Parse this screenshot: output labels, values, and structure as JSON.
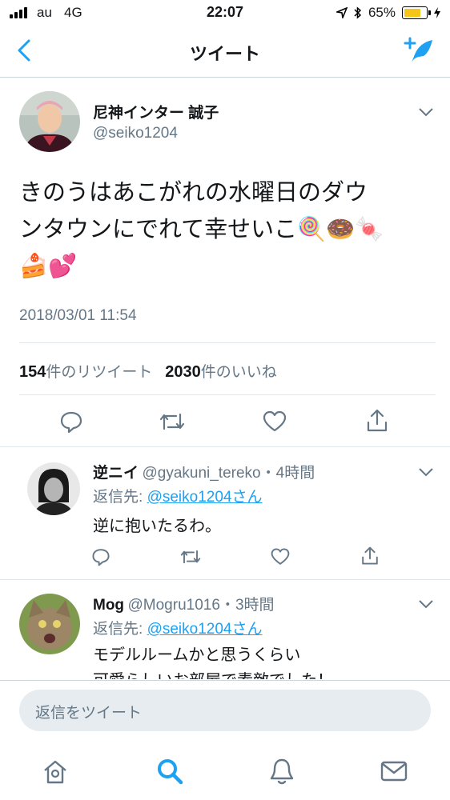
{
  "status_bar": {
    "carrier": "au",
    "network": "4G",
    "time": "22:07",
    "battery": "65%"
  },
  "nav": {
    "title": "ツイート"
  },
  "tweet": {
    "author_name": "尼神インター 誠子",
    "author_handle": "@seiko1204",
    "text_line1": "きのうはあこがれの水曜日のダウ",
    "text_line2": "ンタウンにでれて幸せいこ🍭🍩🍬",
    "text_line3": "🍰💕",
    "timestamp": "2018/03/01 11:54",
    "retweet_count": "154",
    "retweet_label": "件のリツイート",
    "like_count": "2030",
    "like_label": "件のいいね"
  },
  "replies": [
    {
      "name": "逆ニイ",
      "handle": "@gyakuni_tereko",
      "time": "4時間",
      "reply_to_label": "返信先:",
      "reply_to": "@seiko1204さん",
      "text": "逆に抱いたるわ。"
    },
    {
      "name": "Mog",
      "handle": "@Mogru1016",
      "time": "3時間",
      "reply_to_label": "返信先:",
      "reply_to": "@seiko1204さん",
      "text_line1": "モデルルームかと思うくらい",
      "text_line2": "可愛らしいお部屋で素敵でした！"
    }
  ],
  "composer": {
    "placeholder": "返信をツイート"
  },
  "colors": {
    "accent": "#1da1f2",
    "text": "#14171a",
    "secondary": "#657786",
    "divider": "#e1e8ed"
  },
  "icons": [
    "back-chevron-icon",
    "compose-feather-icon",
    "chevron-down-icon",
    "reply-icon",
    "retweet-icon",
    "like-icon",
    "share-icon",
    "home-icon",
    "search-icon",
    "notifications-icon",
    "messages-icon"
  ]
}
